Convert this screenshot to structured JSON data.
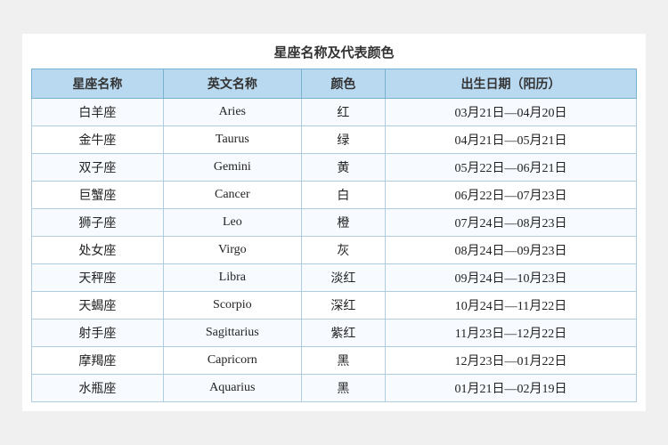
{
  "title": "星座名称及代表颜色",
  "headers": [
    "星座名称",
    "英文名称",
    "颜色",
    "出生日期（阳历）"
  ],
  "rows": [
    {
      "chinese": "白羊座",
      "english": "Aries",
      "color": "红",
      "dates": "03月21日—04月20日"
    },
    {
      "chinese": "金牛座",
      "english": "Taurus",
      "color": "绿",
      "dates": "04月21日—05月21日"
    },
    {
      "chinese": "双子座",
      "english": "Gemini",
      "color": "黄",
      "dates": "05月22日—06月21日"
    },
    {
      "chinese": "巨蟹座",
      "english": "Cancer",
      "color": "白",
      "dates": "06月22日—07月23日"
    },
    {
      "chinese": "狮子座",
      "english": "Leo",
      "color": "橙",
      "dates": "07月24日—08月23日"
    },
    {
      "chinese": "处女座",
      "english": "Virgo",
      "color": "灰",
      "dates": "08月24日—09月23日"
    },
    {
      "chinese": "天秤座",
      "english": "Libra",
      "color": "淡红",
      "dates": "09月24日—10月23日"
    },
    {
      "chinese": "天蝎座",
      "english": "Scorpio",
      "color": "深红",
      "dates": "10月24日—11月22日"
    },
    {
      "chinese": "射手座",
      "english": "Sagittarius",
      "color": "紫红",
      "dates": "11月23日—12月22日"
    },
    {
      "chinese": "摩羯座",
      "english": "Capricorn",
      "color": "黑",
      "dates": "12月23日—01月22日"
    },
    {
      "chinese": "水瓶座",
      "english": "Aquarius",
      "color": "黑",
      "dates": "01月21日—02月19日"
    }
  ]
}
